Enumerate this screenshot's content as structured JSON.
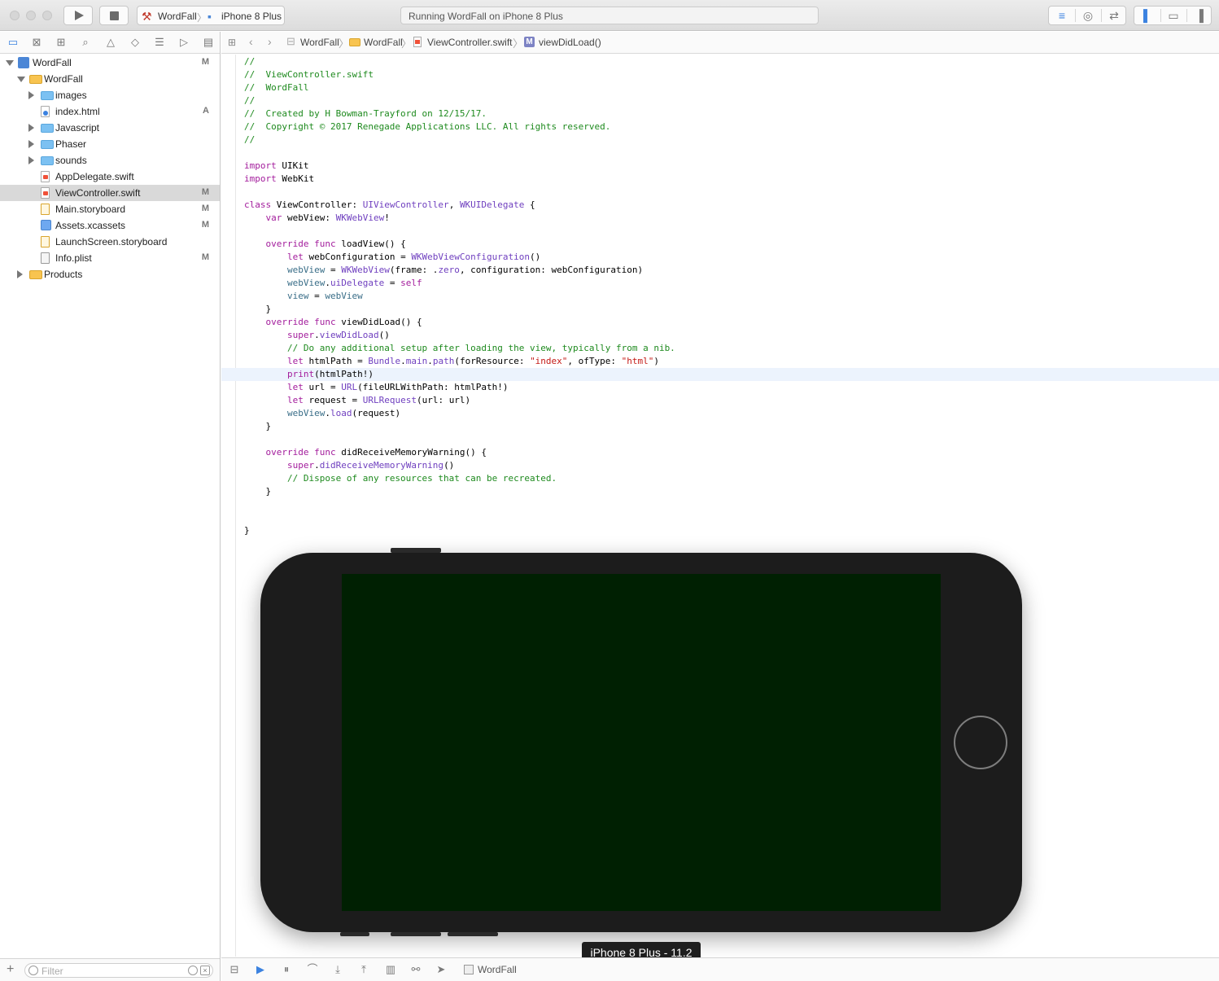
{
  "toolbar": {
    "scheme": {
      "project": "WordFall",
      "device": "iPhone 8 Plus"
    },
    "status": "Running WordFall on iPhone 8 Plus",
    "icons": {
      "run": "play-icon",
      "stop": "stop-icon",
      "editor_modes": [
        "standard-editor-icon",
        "assistant-editor-icon",
        "version-editor-icon"
      ],
      "panels": [
        "navigator-toggle-icon",
        "debug-area-toggle-icon",
        "utilities-toggle-icon"
      ]
    }
  },
  "navigator": {
    "tabs": [
      "folder-icon",
      "source-control-icon",
      "hierarchy-icon",
      "search-icon",
      "warning-icon",
      "test-icon",
      "debug-icon",
      "breakpoint-icon",
      "report-icon"
    ],
    "items": [
      {
        "label": "WordFall",
        "badge": "M",
        "kind": "project",
        "level": 0,
        "disclosure": "open"
      },
      {
        "label": "WordFall",
        "badge": "",
        "kind": "folder-yellow",
        "level": 1,
        "disclosure": "open"
      },
      {
        "label": "images",
        "badge": "",
        "kind": "folder-blue",
        "level": 2,
        "disclosure": "closed"
      },
      {
        "label": "index.html",
        "badge": "A",
        "kind": "html",
        "level": 2,
        "disclosure": ""
      },
      {
        "label": "Javascript",
        "badge": "",
        "kind": "folder-blue",
        "level": 2,
        "disclosure": "closed"
      },
      {
        "label": "Phaser",
        "badge": "",
        "kind": "folder-blue",
        "level": 2,
        "disclosure": "closed"
      },
      {
        "label": "sounds",
        "badge": "",
        "kind": "folder-blue",
        "level": 2,
        "disclosure": "closed"
      },
      {
        "label": "AppDelegate.swift",
        "badge": "",
        "kind": "swift",
        "level": 2,
        "disclosure": ""
      },
      {
        "label": "ViewController.swift",
        "badge": "M",
        "kind": "swift",
        "level": 2,
        "disclosure": "",
        "selected": true
      },
      {
        "label": "Main.storyboard",
        "badge": "M",
        "kind": "storyboard",
        "level": 2,
        "disclosure": ""
      },
      {
        "label": "Assets.xcassets",
        "badge": "M",
        "kind": "xcassets",
        "level": 2,
        "disclosure": ""
      },
      {
        "label": "LaunchScreen.storyboard",
        "badge": "",
        "kind": "storyboard",
        "level": 2,
        "disclosure": ""
      },
      {
        "label": "Info.plist",
        "badge": "M",
        "kind": "plist",
        "level": 2,
        "disclosure": ""
      },
      {
        "label": "Products",
        "badge": "",
        "kind": "folder-yellow",
        "level": 1,
        "disclosure": "closed"
      }
    ],
    "filter": {
      "placeholder": "Filter",
      "value": ""
    }
  },
  "jumpbar": {
    "items": [
      "WordFall",
      "WordFall",
      "ViewController.swift",
      "viewDidLoad()"
    ]
  },
  "editor": {
    "highlighted_line": 25,
    "lines": [
      [
        [
          "com",
          "//"
        ]
      ],
      [
        [
          "com",
          "//  ViewController.swift"
        ]
      ],
      [
        [
          "com",
          "//  WordFall"
        ]
      ],
      [
        [
          "com",
          "//"
        ]
      ],
      [
        [
          "com",
          "//  Created by H Bowman-Trayford on 12/15/17."
        ]
      ],
      [
        [
          "com",
          "//  Copyright © 2017 Renegade Applications LLC. All rights reserved."
        ]
      ],
      [
        [
          "com",
          "//"
        ]
      ],
      [],
      [
        [
          "kw",
          "import"
        ],
        [
          "pl",
          " UIKit"
        ]
      ],
      [
        [
          "kw",
          "import"
        ],
        [
          "pl",
          " WebKit"
        ]
      ],
      [],
      [
        [
          "kw",
          "class"
        ],
        [
          "pl",
          " ViewController: "
        ],
        [
          "ty",
          "UIViewController"
        ],
        [
          "pl",
          ", "
        ],
        [
          "ty",
          "WKUIDelegate"
        ],
        [
          "pl",
          " {"
        ]
      ],
      [
        [
          "pl",
          "    "
        ],
        [
          "kw",
          "var"
        ],
        [
          "pl",
          " webView: "
        ],
        [
          "ty",
          "WKWebView"
        ],
        [
          "pl",
          "!"
        ]
      ],
      [],
      [
        [
          "pl",
          "    "
        ],
        [
          "kw",
          "override"
        ],
        [
          "pl",
          " "
        ],
        [
          "kw",
          "func"
        ],
        [
          "pl",
          " loadView() {"
        ]
      ],
      [
        [
          "pl",
          "        "
        ],
        [
          "kw",
          "let"
        ],
        [
          "pl",
          " webConfiguration = "
        ],
        [
          "ty",
          "WKWebViewConfiguration"
        ],
        [
          "pl",
          "()"
        ]
      ],
      [
        [
          "pl",
          "        "
        ],
        [
          "fn",
          "webView"
        ],
        [
          "pl",
          " = "
        ],
        [
          "ty",
          "WKWebView"
        ],
        [
          "pl",
          "(frame: ."
        ],
        [
          "ty",
          "zero"
        ],
        [
          "pl",
          ", configuration: webConfiguration)"
        ]
      ],
      [
        [
          "pl",
          "        "
        ],
        [
          "fn",
          "webView"
        ],
        [
          "pl",
          "."
        ],
        [
          "ty",
          "uiDelegate"
        ],
        [
          "pl",
          " = "
        ],
        [
          "kw",
          "self"
        ]
      ],
      [
        [
          "pl",
          "        "
        ],
        [
          "fn",
          "view"
        ],
        [
          "pl",
          " = "
        ],
        [
          "fn",
          "webView"
        ]
      ],
      [
        [
          "pl",
          "    }"
        ]
      ],
      [
        [
          "pl",
          "    "
        ],
        [
          "kw",
          "override"
        ],
        [
          "pl",
          " "
        ],
        [
          "kw",
          "func"
        ],
        [
          "pl",
          " viewDidLoad() {"
        ]
      ],
      [
        [
          "pl",
          "        "
        ],
        [
          "kw",
          "super"
        ],
        [
          "pl",
          "."
        ],
        [
          "ty",
          "viewDidLoad"
        ],
        [
          "pl",
          "()"
        ]
      ],
      [
        [
          "pl",
          "        "
        ],
        [
          "com",
          "// Do any additional setup after loading the view, typically from a nib."
        ]
      ],
      [
        [
          "pl",
          "        "
        ],
        [
          "kw",
          "let"
        ],
        [
          "pl",
          " htmlPath = "
        ],
        [
          "ty",
          "Bundle"
        ],
        [
          "pl",
          "."
        ],
        [
          "ty",
          "main"
        ],
        [
          "pl",
          "."
        ],
        [
          "ty",
          "path"
        ],
        [
          "pl",
          "(forResource: "
        ],
        [
          "str",
          "\"index\""
        ],
        [
          "pl",
          ", ofType: "
        ],
        [
          "str",
          "\"html\""
        ],
        [
          "pl",
          ")"
        ]
      ],
      [
        [
          "pl",
          "        "
        ],
        [
          "kw",
          "print"
        ],
        [
          "pl",
          "(htmlPath!)"
        ]
      ],
      [
        [
          "pl",
          "        "
        ],
        [
          "kw",
          "let"
        ],
        [
          "pl",
          " url = "
        ],
        [
          "ty",
          "URL"
        ],
        [
          "pl",
          "(fileURLWithPath: htmlPath!)"
        ]
      ],
      [
        [
          "pl",
          "        "
        ],
        [
          "kw",
          "let"
        ],
        [
          "pl",
          " request = "
        ],
        [
          "ty",
          "URLRequest"
        ],
        [
          "pl",
          "(url: url)"
        ]
      ],
      [
        [
          "pl",
          "        "
        ],
        [
          "fn",
          "webView"
        ],
        [
          "pl",
          "."
        ],
        [
          "ty",
          "load"
        ],
        [
          "pl",
          "(request)"
        ]
      ],
      [
        [
          "pl",
          "    }"
        ]
      ],
      [],
      [
        [
          "pl",
          "    "
        ],
        [
          "kw",
          "override"
        ],
        [
          "pl",
          " "
        ],
        [
          "kw",
          "func"
        ],
        [
          "pl",
          " didReceiveMemoryWarning() {"
        ]
      ],
      [
        [
          "pl",
          "        "
        ],
        [
          "kw",
          "super"
        ],
        [
          "pl",
          "."
        ],
        [
          "ty",
          "didReceiveMemoryWarning"
        ],
        [
          "pl",
          "()"
        ]
      ],
      [
        [
          "pl",
          "        "
        ],
        [
          "com",
          "// Dispose of any resources that can be recreated."
        ]
      ],
      [
        [
          "pl",
          "    }"
        ]
      ],
      [],
      [],
      [
        [
          "pl",
          "}"
        ]
      ]
    ]
  },
  "simulator": {
    "label": "iPhone 8 Plus - 11.2",
    "screen_color": "#002002"
  },
  "debugbar": {
    "icons": [
      "hide-debug-icon",
      "breakpoints-icon",
      "pause-icon",
      "step-over-icon",
      "step-into-icon",
      "step-out-icon",
      "view-debugger-icon",
      "memory-graph-icon",
      "location-icon"
    ],
    "app": "WordFall"
  },
  "colors": {
    "accent": "#3b82e0",
    "comment": "#1e8a1e",
    "keyword": "#a31c9c",
    "type": "#6f3fbf",
    "string": "#c41a16"
  }
}
